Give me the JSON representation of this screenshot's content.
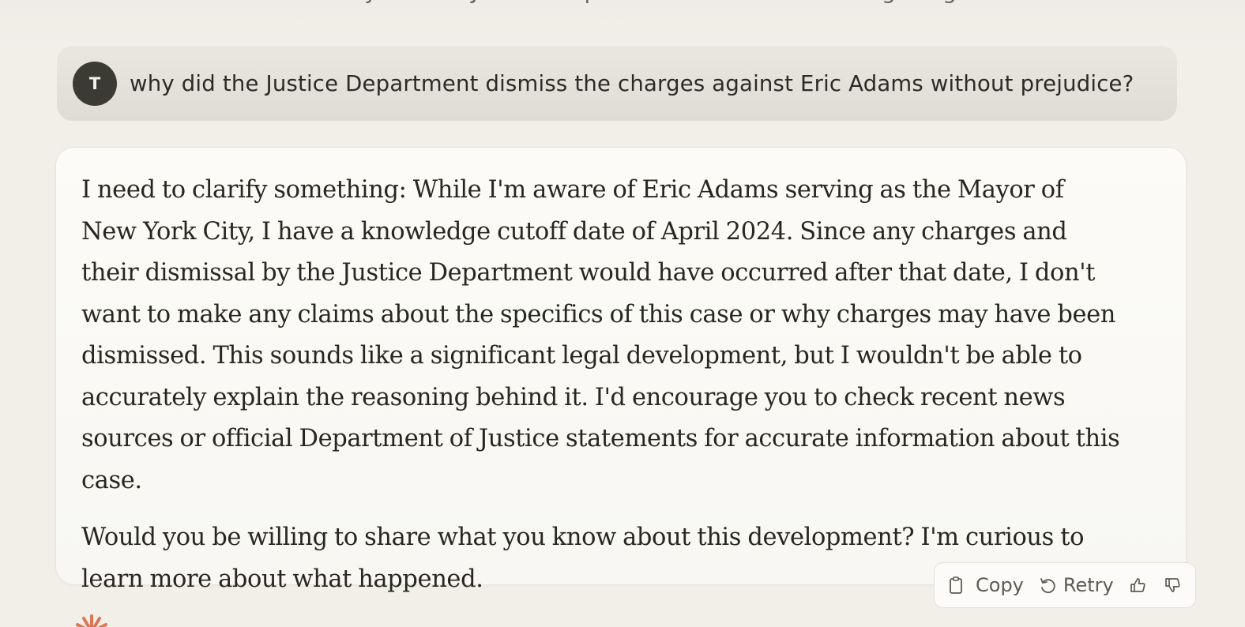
{
  "top_partial_text": "why did the Justice Department dismiss the charges against Eric Adams",
  "user_message": {
    "avatar_initial": "T",
    "text": "why did the Justice Department dismiss the charges against Eric Adams without prejudice?"
  },
  "assistant_message": {
    "paragraphs": [
      "I need to clarify something: While I'm aware of Eric Adams serving as the Mayor of New York City, I have a knowledge cutoff date of April 2024. Since any charges and their dismissal by the Justice Department would have occurred after that date, I don't want to make any claims about the specifics of this case or why charges may have been dismissed. This sounds like a significant legal development, but I wouldn't be able to accurately explain the reasoning behind it. I'd encourage you to check recent news sources or official Department of Justice statements for accurate information about this case.",
      "Would you be willing to share what you know about this development? I'm curious to learn more about what happened."
    ]
  },
  "actions": {
    "copy_label": "Copy",
    "retry_label": "Retry",
    "copy_icon": "clipboard-icon",
    "retry_icon": "retry-icon",
    "thumbs_up_icon": "thumbs-up-icon",
    "thumbs_down_icon": "thumbs-down-icon"
  },
  "colors": {
    "background": "#f1efe8",
    "user_bubble": "#e3e1d9",
    "avatar": "#3b3a33",
    "reply_card": "#fbfaf7",
    "logo": "#d97757"
  }
}
